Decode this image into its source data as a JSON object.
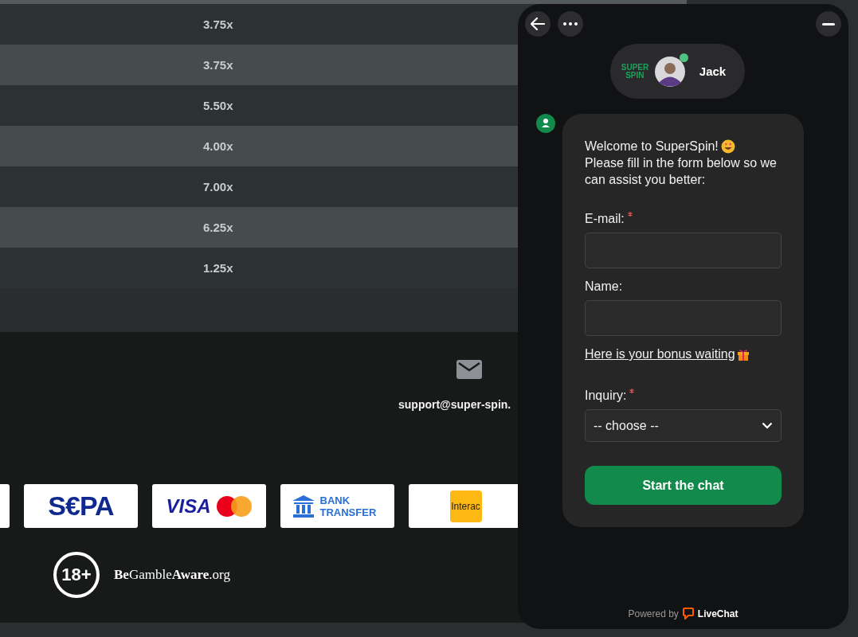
{
  "table": {
    "rows": [
      "3.75x",
      "3.75x",
      "5.50x",
      "4.00x",
      "7.00x",
      "6.25x",
      "1.25x"
    ]
  },
  "footer": {
    "support_email": "support@super-spin.",
    "payment_methods": [
      {
        "kind": "partial"
      },
      {
        "kind": "sepa",
        "label": "S€PA"
      },
      {
        "kind": "visa_mastercard",
        "label": "VISA"
      },
      {
        "kind": "bank",
        "label": "BANK TRANSFER"
      },
      {
        "kind": "interac",
        "label": "Interac"
      }
    ],
    "age_badge": "18+",
    "gamble_aware": "**Be**Gamble**Aware**.org"
  },
  "chat": {
    "agent": {
      "brand": "SUPER SPIN",
      "name": "Jack",
      "online": true
    },
    "welcome": "Welcome to SuperSpin!",
    "intro": "Please fill in the form below so we can assist you better:",
    "fields": [
      {
        "kind": "input",
        "label": "E-mail:",
        "required": true
      },
      {
        "kind": "input",
        "label": "Name:",
        "required": false
      },
      {
        "kind": "link",
        "label": "Here is your bonus waiting"
      },
      {
        "kind": "select",
        "label": "Inquiry:",
        "required": true,
        "value": "-- choose --"
      }
    ],
    "submit": "Start the chat",
    "powered_by": "Powered by",
    "provider": "LiveChat"
  }
}
